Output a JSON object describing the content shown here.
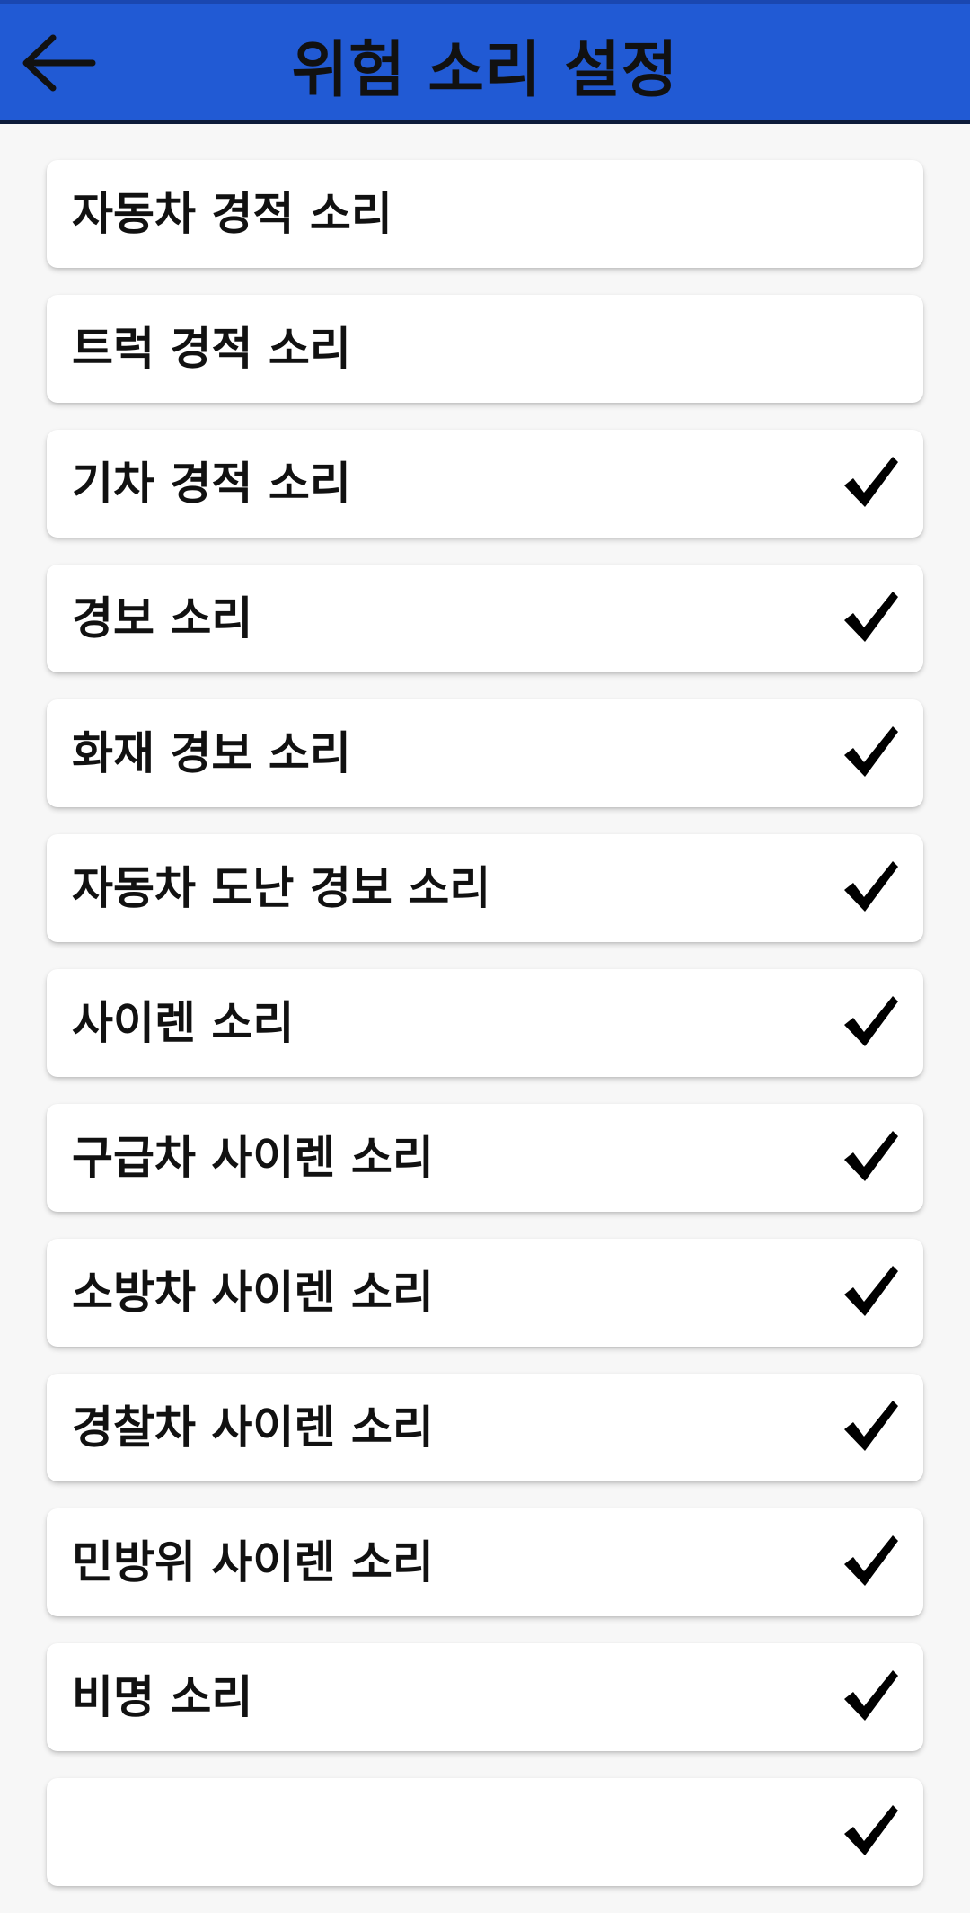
{
  "header": {
    "title": "위험 소리 설정",
    "back_icon": "arrow-left-icon",
    "bg_color": "#215ad4"
  },
  "items": [
    {
      "label": "자동차 경적 소리",
      "checked": false
    },
    {
      "label": "트럭 경적 소리",
      "checked": false
    },
    {
      "label": "기차 경적 소리",
      "checked": true
    },
    {
      "label": "경보 소리",
      "checked": true
    },
    {
      "label": "화재 경보 소리",
      "checked": true
    },
    {
      "label": "자동차 도난 경보 소리",
      "checked": true
    },
    {
      "label": "사이렌 소리",
      "checked": true
    },
    {
      "label": "구급차 사이렌 소리",
      "checked": true
    },
    {
      "label": "소방차 사이렌 소리",
      "checked": true
    },
    {
      "label": "경찰차 사이렌 소리",
      "checked": true
    },
    {
      "label": "민방위 사이렌 소리",
      "checked": true
    },
    {
      "label": "비명 소리",
      "checked": true
    },
    {
      "label": "",
      "checked": true
    }
  ],
  "check_icon": "checkmark-icon"
}
